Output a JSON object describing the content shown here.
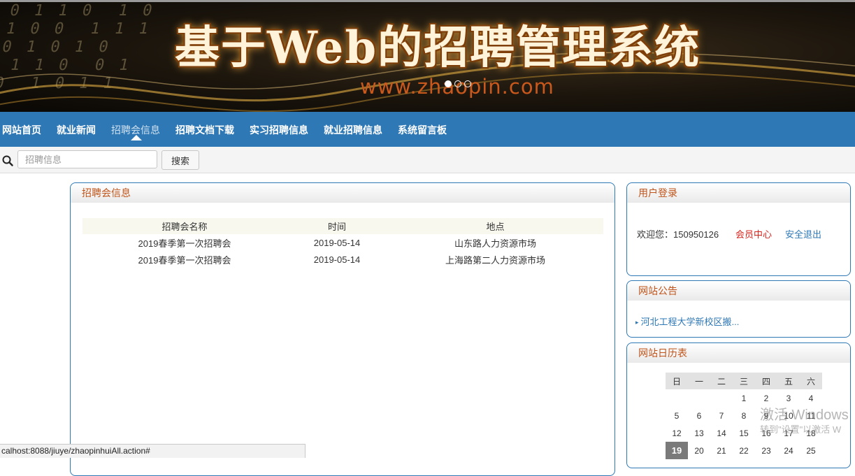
{
  "banner": {
    "title": "基于Web的招聘管理系统",
    "url": "www.zhaopin.com"
  },
  "nav": {
    "items": [
      {
        "label": "网站首页"
      },
      {
        "label": "就业新闻"
      },
      {
        "label": "招聘会信息"
      },
      {
        "label": "招聘文档下载"
      },
      {
        "label": "实习招聘信息"
      },
      {
        "label": "就业招聘信息"
      },
      {
        "label": "系统留言板"
      }
    ],
    "active_index": 2
  },
  "search": {
    "placeholder": "招聘信息",
    "value": "",
    "button_label": "搜索"
  },
  "main": {
    "title": "招聘会信息",
    "columns": [
      "招聘会名称",
      "时间",
      "地点"
    ],
    "rows": [
      [
        "2019春季第一次招聘会",
        "2019-05-14",
        "山东路人力资源市场"
      ],
      [
        "2019春季第一次招聘会",
        "2019-05-14",
        "上海路第二人力资源市场"
      ]
    ]
  },
  "login": {
    "title": "用户登录",
    "welcome": "欢迎您：150950126",
    "member_link": "会员中心",
    "logout_link": "安全退出"
  },
  "notice": {
    "title": "网站公告",
    "items": [
      "河北工程大学新校区搬..."
    ]
  },
  "calendar": {
    "title": "网站日历表",
    "weekdays": [
      "日",
      "一",
      "二",
      "三",
      "四",
      "五",
      "六"
    ],
    "weeks": [
      [
        "",
        "",
        "",
        "1",
        "2",
        "3",
        "4"
      ],
      [
        "5",
        "6",
        "7",
        "8",
        "9",
        "10",
        "11"
      ],
      [
        "12",
        "13",
        "14",
        "15",
        "16",
        "17",
        "18"
      ],
      [
        "19",
        "20",
        "21",
        "22",
        "23",
        "24",
        "25"
      ]
    ],
    "today": "19"
  },
  "statusbar": {
    "text": "calhost:8088/jiuye/zhaopinhuiAll.action#"
  },
  "watermark": {
    "line1": "激活 Windows",
    "line2": "转到\"设置\"以激活 W"
  }
}
